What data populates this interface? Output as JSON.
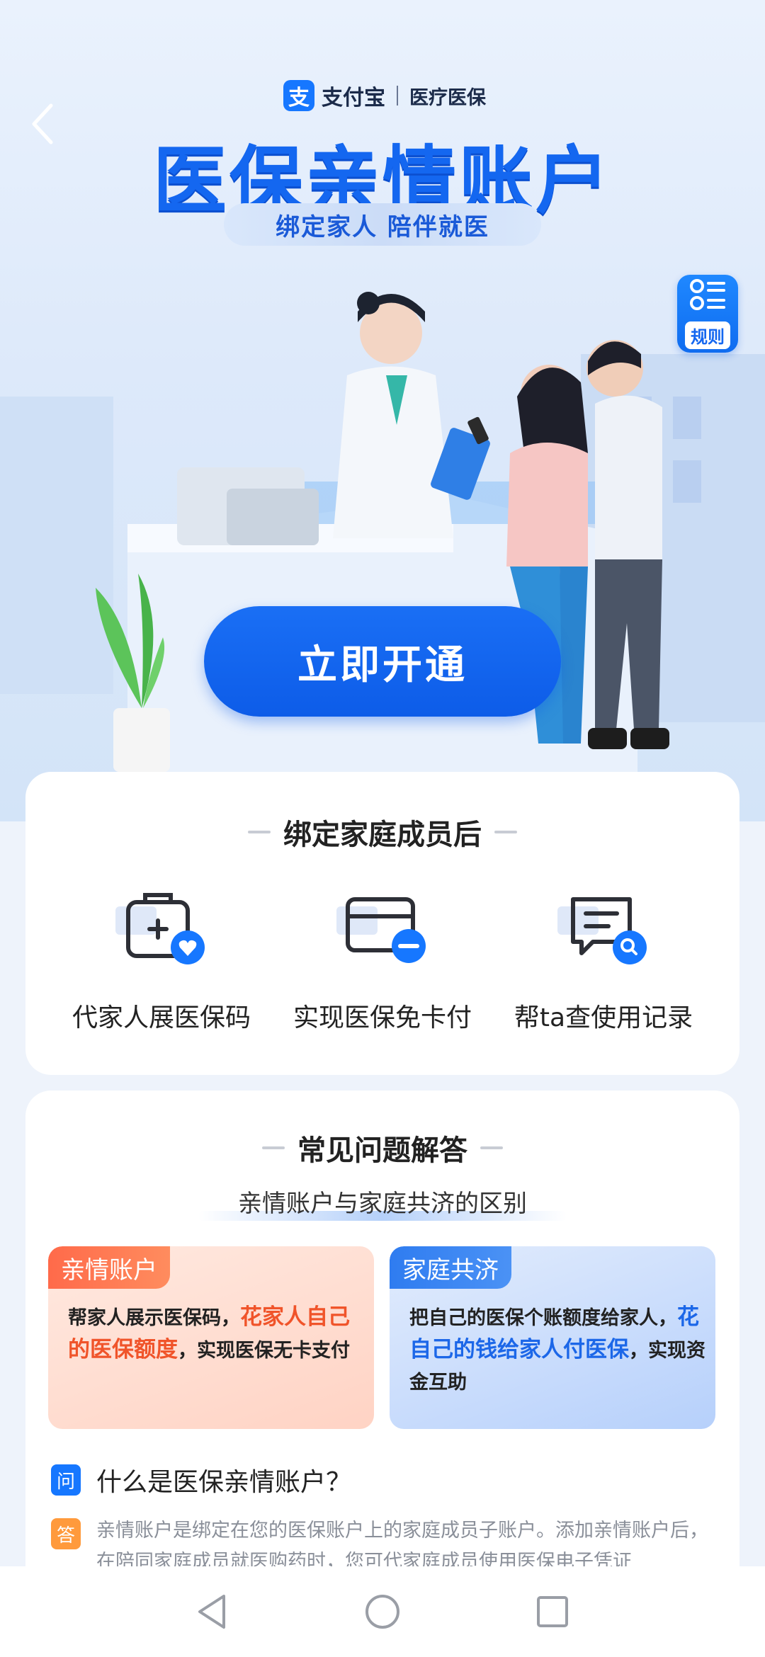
{
  "header": {
    "brand_logo_char": "支",
    "brand_name": "支付宝",
    "brand_sub": "医疗医保",
    "title": "医保亲情账户",
    "subtitle": "绑定家人 陪伴就医",
    "rules_label": "规则"
  },
  "cta": {
    "label": "立即开通"
  },
  "benefits": {
    "title": "绑定家庭成员后",
    "items": [
      {
        "label": "代家人展医保码",
        "icon": "medical-kit-heart-icon"
      },
      {
        "label": "实现医保免卡付",
        "icon": "card-minus-icon"
      },
      {
        "label": "帮ta查使用记录",
        "icon": "record-search-icon"
      }
    ]
  },
  "faq": {
    "title": "常见问题解答",
    "compare_title": "亲情账户与家庭共济的区别",
    "cards": [
      {
        "tag": "亲情账户",
        "text_pre": "帮家人展示医保码，",
        "text_em": "花家人自己的医保额度",
        "text_post": "，实现医保无卡支付"
      },
      {
        "tag": "家庭共济",
        "text_pre": "把自己的医保个账额度给家人，",
        "text_em": "花自己的钱给家人付医保",
        "text_post": "，实现资金互助"
      }
    ],
    "question_badge": "问",
    "question": "什么是医保亲情账户？",
    "answer_badge": "答",
    "answer": "亲情账户是绑定在您的医保账户上的家庭成员子账户。添加亲情账户后，在陪同家庭成员就医购药时，您可代家庭成员使用医保电子凭证"
  },
  "colors": {
    "primary": "#1467f0",
    "accent_orange": "#f0542a",
    "answer_badge": "#ff9a3c"
  }
}
